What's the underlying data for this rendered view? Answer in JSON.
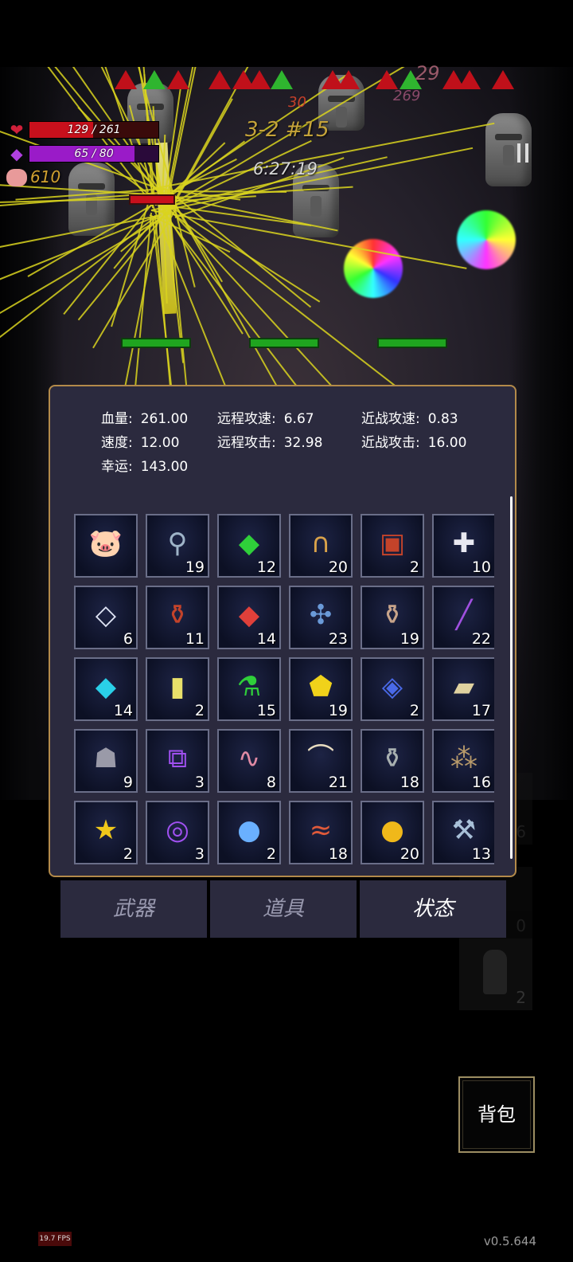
{
  "hud": {
    "hp_text": "129 / 261",
    "hp_fraction": 0.494,
    "mp_text": "65 / 80",
    "mp_fraction": 0.8125,
    "coins": "610",
    "level": "3-2 #15",
    "timer": "6:27:19",
    "heart_icon": "heart-icon",
    "gem_icon": "gem-icon",
    "pig_icon": "pig-icon"
  },
  "damage_numbers": [
    "30",
    "269",
    "29"
  ],
  "stats": [
    {
      "label": "血量:",
      "value": "261.00"
    },
    {
      "label": "远程攻速:",
      "value": "6.67"
    },
    {
      "label": "近战攻速:",
      "value": "0.83"
    },
    {
      "label": "速度:",
      "value": "12.00"
    },
    {
      "label": "远程攻击:",
      "value": "32.98"
    },
    {
      "label": "近战攻击:",
      "value": "16.00"
    },
    {
      "label": "幸运:",
      "value": "143.00"
    }
  ],
  "items": [
    {
      "icon": "piggy-bank-icon",
      "count": ""
    },
    {
      "icon": "bottle-icon",
      "count": "19"
    },
    {
      "icon": "green-crystal-icon",
      "count": "12"
    },
    {
      "icon": "horseshoe-icon",
      "count": "20"
    },
    {
      "icon": "spellbook-icon",
      "count": "2"
    },
    {
      "icon": "medkit-icon",
      "count": "10"
    },
    {
      "icon": "diamond-tile-icon",
      "count": "6"
    },
    {
      "icon": "sparkling-pot-icon",
      "count": "11"
    },
    {
      "icon": "red-crystal-icon",
      "count": "14"
    },
    {
      "icon": "dragonfly-icon",
      "count": "23"
    },
    {
      "icon": "vase-icon",
      "count": "19"
    },
    {
      "icon": "purple-vial-icon",
      "count": "22"
    },
    {
      "icon": "cyan-crystal-icon",
      "count": "14"
    },
    {
      "icon": "yellow-card-icon",
      "count": "2"
    },
    {
      "icon": "green-potion-icon",
      "count": "15"
    },
    {
      "icon": "yellow-gem-icon",
      "count": "19"
    },
    {
      "icon": "blue-tome-icon",
      "count": "2"
    },
    {
      "icon": "ore-chunks-icon",
      "count": "17"
    },
    {
      "icon": "cloak-statue-icon",
      "count": "9"
    },
    {
      "icon": "purple-rune-icon",
      "count": "3"
    },
    {
      "icon": "worm-icon",
      "count": "8"
    },
    {
      "icon": "horn-icon",
      "count": "21"
    },
    {
      "icon": "flask-icon",
      "count": "18"
    },
    {
      "icon": "stones-icon",
      "count": "16"
    },
    {
      "icon": "star-trophy-icon",
      "count": "2"
    },
    {
      "icon": "spiral-rune-icon",
      "count": "3"
    },
    {
      "icon": "blue-orb-icon",
      "count": "2"
    },
    {
      "icon": "fish-pair-icon",
      "count": "18"
    },
    {
      "icon": "gold-coin-icon",
      "count": "20"
    },
    {
      "icon": "hammer-icon",
      "count": "13"
    }
  ],
  "tabs": [
    {
      "label": "武器",
      "active": false
    },
    {
      "label": "道具",
      "active": false
    },
    {
      "label": "状态",
      "active": true
    }
  ],
  "side_items": [
    {
      "count": "6"
    },
    {
      "count": "0"
    },
    {
      "count": "2"
    }
  ],
  "backpack_label": "背包",
  "fps": "19.7 FPS",
  "version": "v0.5.644",
  "colors": {
    "hp": "#c8101c",
    "mp": "#9a1bc8",
    "panel_bg": "#2b2a3e",
    "panel_border": "#b38a4a",
    "level_text": "#c5a33a"
  }
}
